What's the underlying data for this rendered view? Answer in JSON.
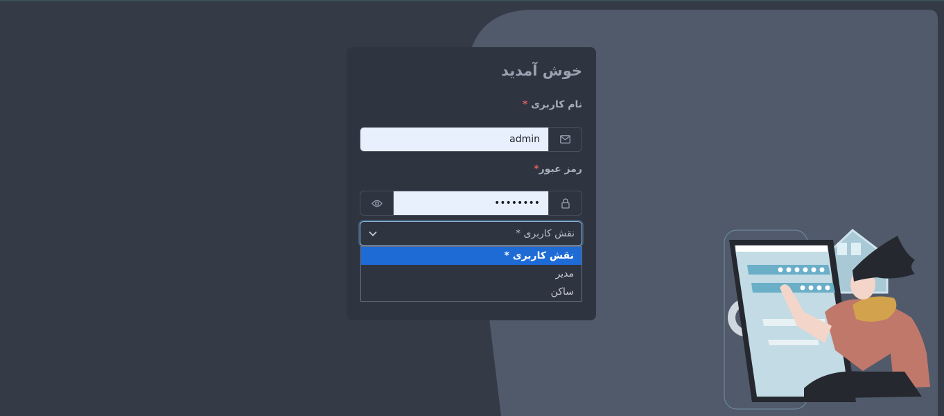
{
  "login": {
    "title": "خوش آمدید",
    "username_label": "نام کاربری",
    "username_required": "*",
    "username_value": "admin",
    "password_label": "رمز عبور",
    "password_required": "*",
    "password_value": "••••••••",
    "role_placeholder": "نقش کاربری *",
    "role_options": [
      "نقش کاربری *",
      "مدیر",
      "ساکن"
    ],
    "role_selected_index": 0
  },
  "icons": {
    "username_addon": "envelope-icon",
    "password_addon": "lock-icon",
    "password_toggle": "eye-icon",
    "select_caret": "chevron-down-icon"
  },
  "colors": {
    "background": "#353a47",
    "card": "#2f3441",
    "illustration_panel": "#515a6b",
    "selected_option": "#1e6bd6",
    "required_mark": "#e0605a"
  }
}
